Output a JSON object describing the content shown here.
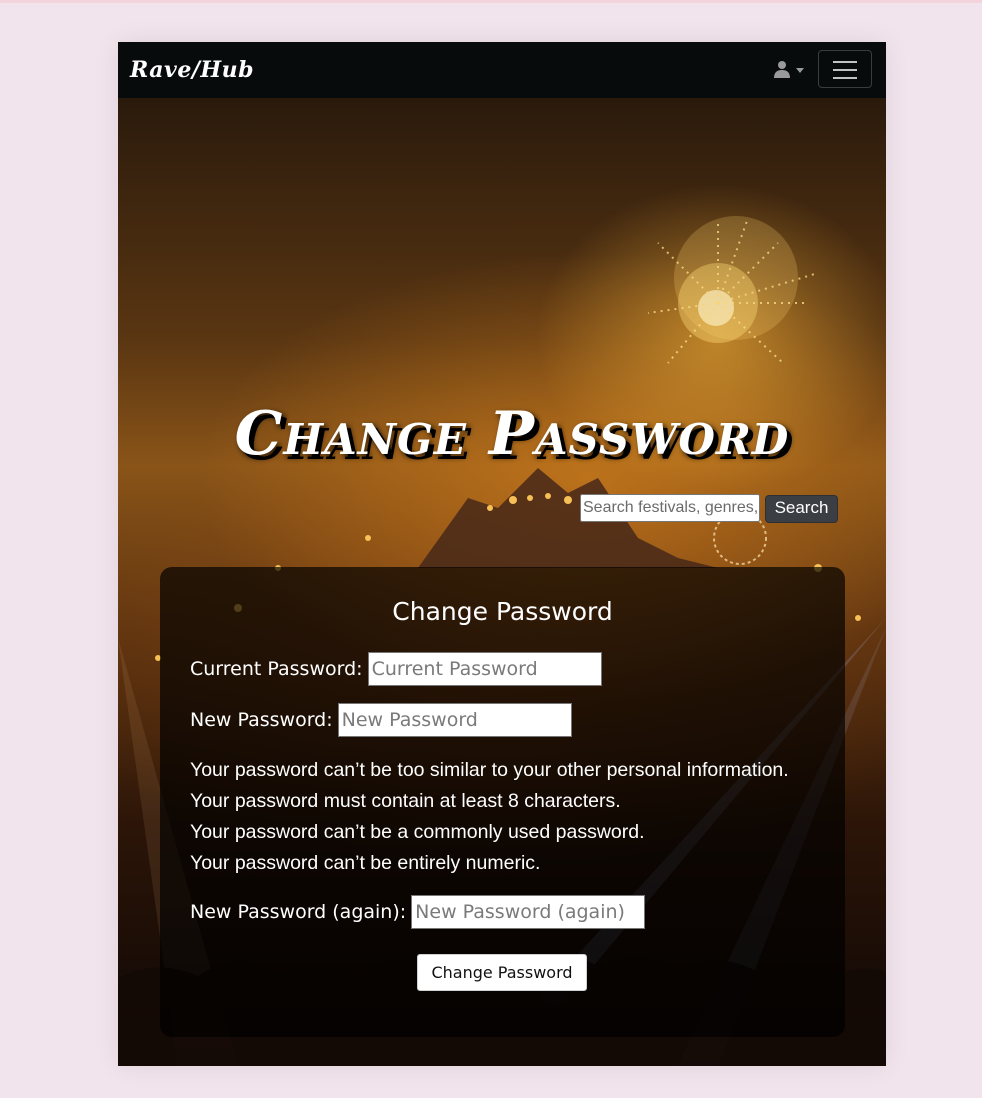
{
  "navbar": {
    "brand": "Rave/Hub",
    "user_icon": "user-icon",
    "caret_icon": "caret-down-icon",
    "menu_icon": "hamburger-menu-icon"
  },
  "hero": {
    "title": "Change Password"
  },
  "search": {
    "placeholder": "Search festivals, genres, artists...",
    "button_label": "Search"
  },
  "form": {
    "title": "Change Password",
    "current_password": {
      "label": "Current Password:",
      "placeholder": "Current Password"
    },
    "new_password": {
      "label": "New Password:",
      "placeholder": "New Password"
    },
    "help_text": [
      "Your password can’t be too similar to your other personal information.",
      "Your password must contain at least 8 characters.",
      "Your password can’t be a commonly used password.",
      "Your password can’t be entirely numeric."
    ],
    "new_password_again": {
      "label": "New Password (again):",
      "placeholder": "New Password (again)"
    },
    "submit_label": "Change Password"
  },
  "colors": {
    "page_background": "#f2e4ec",
    "navbar_background": "#070b0c",
    "search_button": "#3b3f43"
  }
}
